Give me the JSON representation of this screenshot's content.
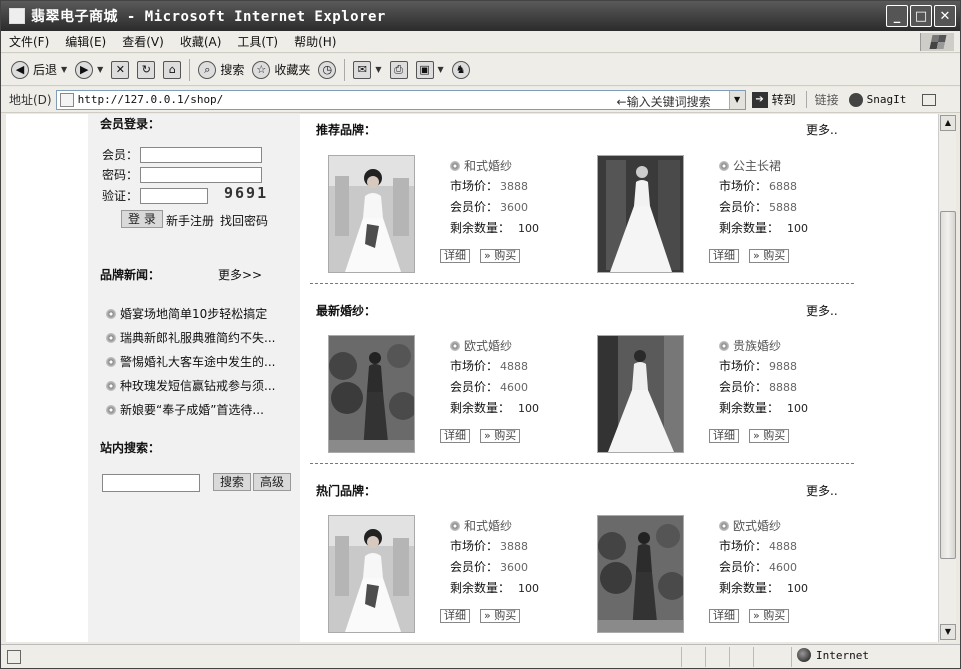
{
  "window": {
    "title": "翡翠电子商城 - Microsoft Internet Explorer"
  },
  "menu": [
    "文件(F)",
    "编辑(E)",
    "查看(V)",
    "收藏(A)",
    "工具(T)",
    "帮助(H)"
  ],
  "toolbar": {
    "back": "后退",
    "search": "搜索",
    "favorites": "收藏夹"
  },
  "address": {
    "label": "地址(D)",
    "url": "http://127.0.0.1/shop/",
    "hint": "←输入关键词搜索",
    "go": "转到",
    "links": "链接",
    "snagit": "SnagIt"
  },
  "login": {
    "title": "会员登录：",
    "member_label": "会员：",
    "password_label": "密码：",
    "verify_label": "验证：",
    "captcha": "9691",
    "login_btn": "登 录",
    "register": "新手注册",
    "recover": "找回密码"
  },
  "news": {
    "title": "品牌新闻：",
    "more": "更多>>",
    "items": [
      "婚宴场地简单10步轻松搞定",
      "瑞典新郎礼服典雅简约不失...",
      "警惕婚礼大客车途中发生的...",
      "种玫瑰发短信赢钻戒参与须...",
      "新娘要“奉子成婚”首选待..."
    ]
  },
  "site_search": {
    "title": "站内搜索：",
    "search_btn": "搜索",
    "advanced_btn": "高级"
  },
  "common": {
    "market_label": "市场价：",
    "member_label": "会员价：",
    "remain_label": "剩余数量：",
    "detail_btn": "详细",
    "buy_btn": "购买",
    "more": "更多.."
  },
  "sections": [
    {
      "title": "推荐品牌：",
      "products": [
        {
          "name": "和式婚纱",
          "market": "3888",
          "member": "3600",
          "remain": "100"
        },
        {
          "name": "公主长裙",
          "market": "6888",
          "member": "5888",
          "remain": "100"
        }
      ]
    },
    {
      "title": "最新婚纱：",
      "products": [
        {
          "name": "欧式婚纱",
          "market": "4888",
          "member": "4600",
          "remain": "100"
        },
        {
          "name": "贵族婚纱",
          "market": "9888",
          "member": "8888",
          "remain": "100"
        }
      ]
    },
    {
      "title": "热门品牌：",
      "products": [
        {
          "name": "和式婚纱",
          "market": "3888",
          "member": "3600",
          "remain": "100"
        },
        {
          "name": "欧式婚纱",
          "market": "4888",
          "member": "4600",
          "remain": "100"
        }
      ]
    }
  ],
  "status": {
    "zone": "Internet"
  }
}
